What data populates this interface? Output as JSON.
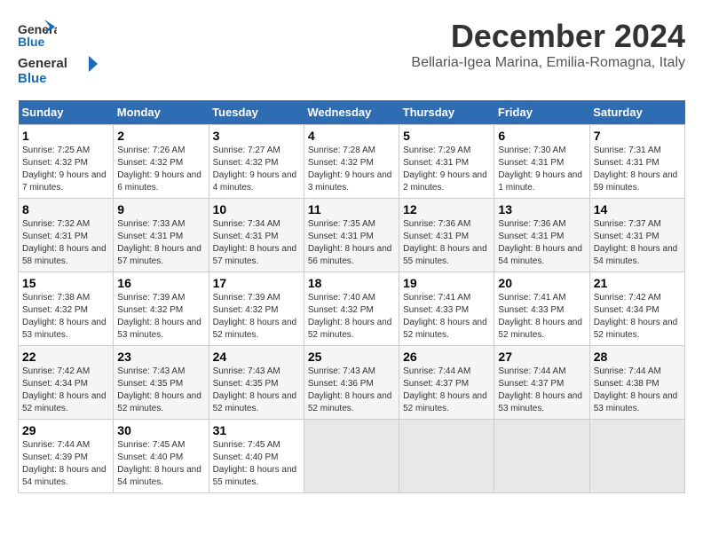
{
  "header": {
    "logo_line1": "General",
    "logo_line2": "Blue",
    "month": "December 2024",
    "location": "Bellaria-Igea Marina, Emilia-Romagna, Italy"
  },
  "days_of_week": [
    "Sunday",
    "Monday",
    "Tuesday",
    "Wednesday",
    "Thursday",
    "Friday",
    "Saturday"
  ],
  "weeks": [
    [
      {
        "day": "1",
        "sunrise": "Sunrise: 7:25 AM",
        "sunset": "Sunset: 4:32 PM",
        "daylight": "Daylight: 9 hours and 7 minutes."
      },
      {
        "day": "2",
        "sunrise": "Sunrise: 7:26 AM",
        "sunset": "Sunset: 4:32 PM",
        "daylight": "Daylight: 9 hours and 6 minutes."
      },
      {
        "day": "3",
        "sunrise": "Sunrise: 7:27 AM",
        "sunset": "Sunset: 4:32 PM",
        "daylight": "Daylight: 9 hours and 4 minutes."
      },
      {
        "day": "4",
        "sunrise": "Sunrise: 7:28 AM",
        "sunset": "Sunset: 4:32 PM",
        "daylight": "Daylight: 9 hours and 3 minutes."
      },
      {
        "day": "5",
        "sunrise": "Sunrise: 7:29 AM",
        "sunset": "Sunset: 4:31 PM",
        "daylight": "Daylight: 9 hours and 2 minutes."
      },
      {
        "day": "6",
        "sunrise": "Sunrise: 7:30 AM",
        "sunset": "Sunset: 4:31 PM",
        "daylight": "Daylight: 9 hours and 1 minute."
      },
      {
        "day": "7",
        "sunrise": "Sunrise: 7:31 AM",
        "sunset": "Sunset: 4:31 PM",
        "daylight": "Daylight: 8 hours and 59 minutes."
      }
    ],
    [
      {
        "day": "8",
        "sunrise": "Sunrise: 7:32 AM",
        "sunset": "Sunset: 4:31 PM",
        "daylight": "Daylight: 8 hours and 58 minutes."
      },
      {
        "day": "9",
        "sunrise": "Sunrise: 7:33 AM",
        "sunset": "Sunset: 4:31 PM",
        "daylight": "Daylight: 8 hours and 57 minutes."
      },
      {
        "day": "10",
        "sunrise": "Sunrise: 7:34 AM",
        "sunset": "Sunset: 4:31 PM",
        "daylight": "Daylight: 8 hours and 57 minutes."
      },
      {
        "day": "11",
        "sunrise": "Sunrise: 7:35 AM",
        "sunset": "Sunset: 4:31 PM",
        "daylight": "Daylight: 8 hours and 56 minutes."
      },
      {
        "day": "12",
        "sunrise": "Sunrise: 7:36 AM",
        "sunset": "Sunset: 4:31 PM",
        "daylight": "Daylight: 8 hours and 55 minutes."
      },
      {
        "day": "13",
        "sunrise": "Sunrise: 7:36 AM",
        "sunset": "Sunset: 4:31 PM",
        "daylight": "Daylight: 8 hours and 54 minutes."
      },
      {
        "day": "14",
        "sunrise": "Sunrise: 7:37 AM",
        "sunset": "Sunset: 4:31 PM",
        "daylight": "Daylight: 8 hours and 54 minutes."
      }
    ],
    [
      {
        "day": "15",
        "sunrise": "Sunrise: 7:38 AM",
        "sunset": "Sunset: 4:32 PM",
        "daylight": "Daylight: 8 hours and 53 minutes."
      },
      {
        "day": "16",
        "sunrise": "Sunrise: 7:39 AM",
        "sunset": "Sunset: 4:32 PM",
        "daylight": "Daylight: 8 hours and 53 minutes."
      },
      {
        "day": "17",
        "sunrise": "Sunrise: 7:39 AM",
        "sunset": "Sunset: 4:32 PM",
        "daylight": "Daylight: 8 hours and 52 minutes."
      },
      {
        "day": "18",
        "sunrise": "Sunrise: 7:40 AM",
        "sunset": "Sunset: 4:32 PM",
        "daylight": "Daylight: 8 hours and 52 minutes."
      },
      {
        "day": "19",
        "sunrise": "Sunrise: 7:41 AM",
        "sunset": "Sunset: 4:33 PM",
        "daylight": "Daylight: 8 hours and 52 minutes."
      },
      {
        "day": "20",
        "sunrise": "Sunrise: 7:41 AM",
        "sunset": "Sunset: 4:33 PM",
        "daylight": "Daylight: 8 hours and 52 minutes."
      },
      {
        "day": "21",
        "sunrise": "Sunrise: 7:42 AM",
        "sunset": "Sunset: 4:34 PM",
        "daylight": "Daylight: 8 hours and 52 minutes."
      }
    ],
    [
      {
        "day": "22",
        "sunrise": "Sunrise: 7:42 AM",
        "sunset": "Sunset: 4:34 PM",
        "daylight": "Daylight: 8 hours and 52 minutes."
      },
      {
        "day": "23",
        "sunrise": "Sunrise: 7:43 AM",
        "sunset": "Sunset: 4:35 PM",
        "daylight": "Daylight: 8 hours and 52 minutes."
      },
      {
        "day": "24",
        "sunrise": "Sunrise: 7:43 AM",
        "sunset": "Sunset: 4:35 PM",
        "daylight": "Daylight: 8 hours and 52 minutes."
      },
      {
        "day": "25",
        "sunrise": "Sunrise: 7:43 AM",
        "sunset": "Sunset: 4:36 PM",
        "daylight": "Daylight: 8 hours and 52 minutes."
      },
      {
        "day": "26",
        "sunrise": "Sunrise: 7:44 AM",
        "sunset": "Sunset: 4:37 PM",
        "daylight": "Daylight: 8 hours and 52 minutes."
      },
      {
        "day": "27",
        "sunrise": "Sunrise: 7:44 AM",
        "sunset": "Sunset: 4:37 PM",
        "daylight": "Daylight: 8 hours and 53 minutes."
      },
      {
        "day": "28",
        "sunrise": "Sunrise: 7:44 AM",
        "sunset": "Sunset: 4:38 PM",
        "daylight": "Daylight: 8 hours and 53 minutes."
      }
    ],
    [
      {
        "day": "29",
        "sunrise": "Sunrise: 7:44 AM",
        "sunset": "Sunset: 4:39 PM",
        "daylight": "Daylight: 8 hours and 54 minutes."
      },
      {
        "day": "30",
        "sunrise": "Sunrise: 7:45 AM",
        "sunset": "Sunset: 4:40 PM",
        "daylight": "Daylight: 8 hours and 54 minutes."
      },
      {
        "day": "31",
        "sunrise": "Sunrise: 7:45 AM",
        "sunset": "Sunset: 4:40 PM",
        "daylight": "Daylight: 8 hours and 55 minutes."
      },
      null,
      null,
      null,
      null
    ]
  ]
}
